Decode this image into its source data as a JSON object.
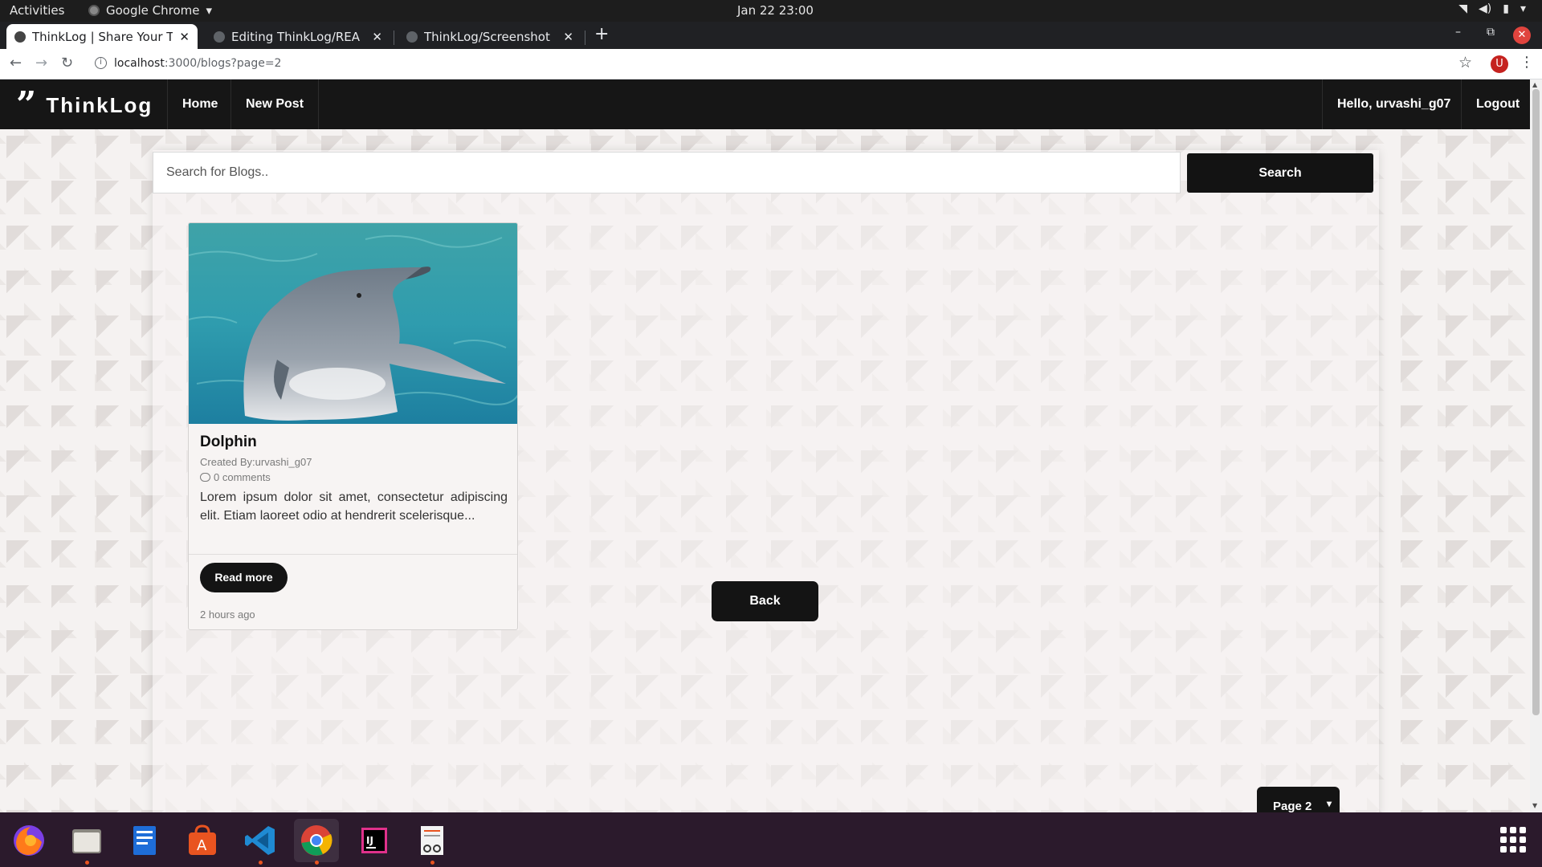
{
  "system": {
    "activities": "Activities",
    "app_name": "Google Chrome",
    "clock": "Jan 22  23:00"
  },
  "browser": {
    "tabs": [
      {
        "title": "ThinkLog | Share Your Thc",
        "active": true
      },
      {
        "title": "Editing ThinkLog/READM",
        "active": false
      },
      {
        "title": "ThinkLog/Screenshot fro",
        "active": false
      }
    ],
    "url_host": "localhost",
    "url_path": ":3000/blogs?page=2",
    "profile_initial": "U"
  },
  "site": {
    "brand": "ThinkLog",
    "brand_icon": "”",
    "nav": {
      "home": "Home",
      "new_post": "New Post",
      "greeting": "Hello, urvashi_g07",
      "logout": "Logout"
    },
    "search": {
      "placeholder": "Search for Blogs..",
      "button": "Search"
    },
    "posts": [
      {
        "title": "Dolphin",
        "created_by": "Created By:urvashi_g07",
        "comments": "0 comments",
        "excerpt": "Lorem ipsum dolor sit amet, consectetur adipiscing elit. Etiam laoreet odio at hendrerit scelerisque...",
        "read_more": "Read more",
        "time": "2 hours ago"
      }
    ],
    "back_button": "Back",
    "page_select": "Page 2"
  },
  "colors": {
    "navbar": "#161616",
    "page_bg": "#f5f2f1",
    "button": "#141414",
    "dock": "#2b1a2c"
  },
  "dock": {
    "apps": [
      "firefox-icon",
      "files-icon",
      "text-editor-icon",
      "software-center-icon",
      "vscode-icon",
      "chrome-icon",
      "intellij-icon",
      "document-viewer-icon"
    ]
  }
}
